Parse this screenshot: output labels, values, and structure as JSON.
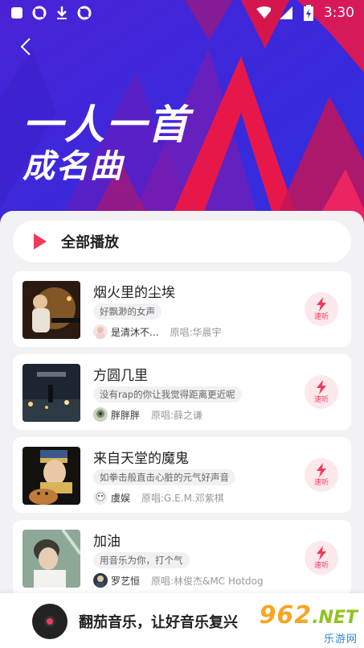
{
  "status_bar": {
    "time": "3:30",
    "left_icons": [
      "app-square-icon",
      "sync-icon",
      "download-icon",
      "sync-icon"
    ],
    "right_icons": [
      "wifi-icon",
      "signal-icon",
      "battery-charging-icon"
    ]
  },
  "hero": {
    "title_line1": "一人一首",
    "title_line2": "成名曲"
  },
  "play_all": {
    "label": "全部播放"
  },
  "songs": [
    {
      "title": "烟火里的尘埃",
      "tag": "好飘渺的女声",
      "singer": "是清沐不...",
      "original": "原唱:华晨宇",
      "listen": "速听"
    },
    {
      "title": "方圆几里",
      "tag": "没有rap的你让我觉得距离更近呢",
      "singer": "胖胖胖",
      "original": "原唱:薛之谦",
      "listen": "速听"
    },
    {
      "title": "来自天堂的魔鬼",
      "tag": "如拳击般直击心脏的元气好声音",
      "singer": "虞娱",
      "original": "原唱:G.E.M.邓紫棋",
      "listen": "速听"
    },
    {
      "title": "加油",
      "tag": "用音乐为你，打个气",
      "singer": "罗艺恒",
      "original": "原唱:林俊杰&MC Hotdog",
      "listen": "速听"
    }
  ],
  "bottom_bar": {
    "slogan": "翻茄音乐，让好音乐复兴"
  },
  "watermark": {
    "number": "962",
    "domain": ".NET",
    "subtitle": "乐游网"
  },
  "colors": {
    "accent": "#ef3b5a",
    "hero_blue": "#3a1fc7",
    "hero_red": "#e8174a"
  }
}
